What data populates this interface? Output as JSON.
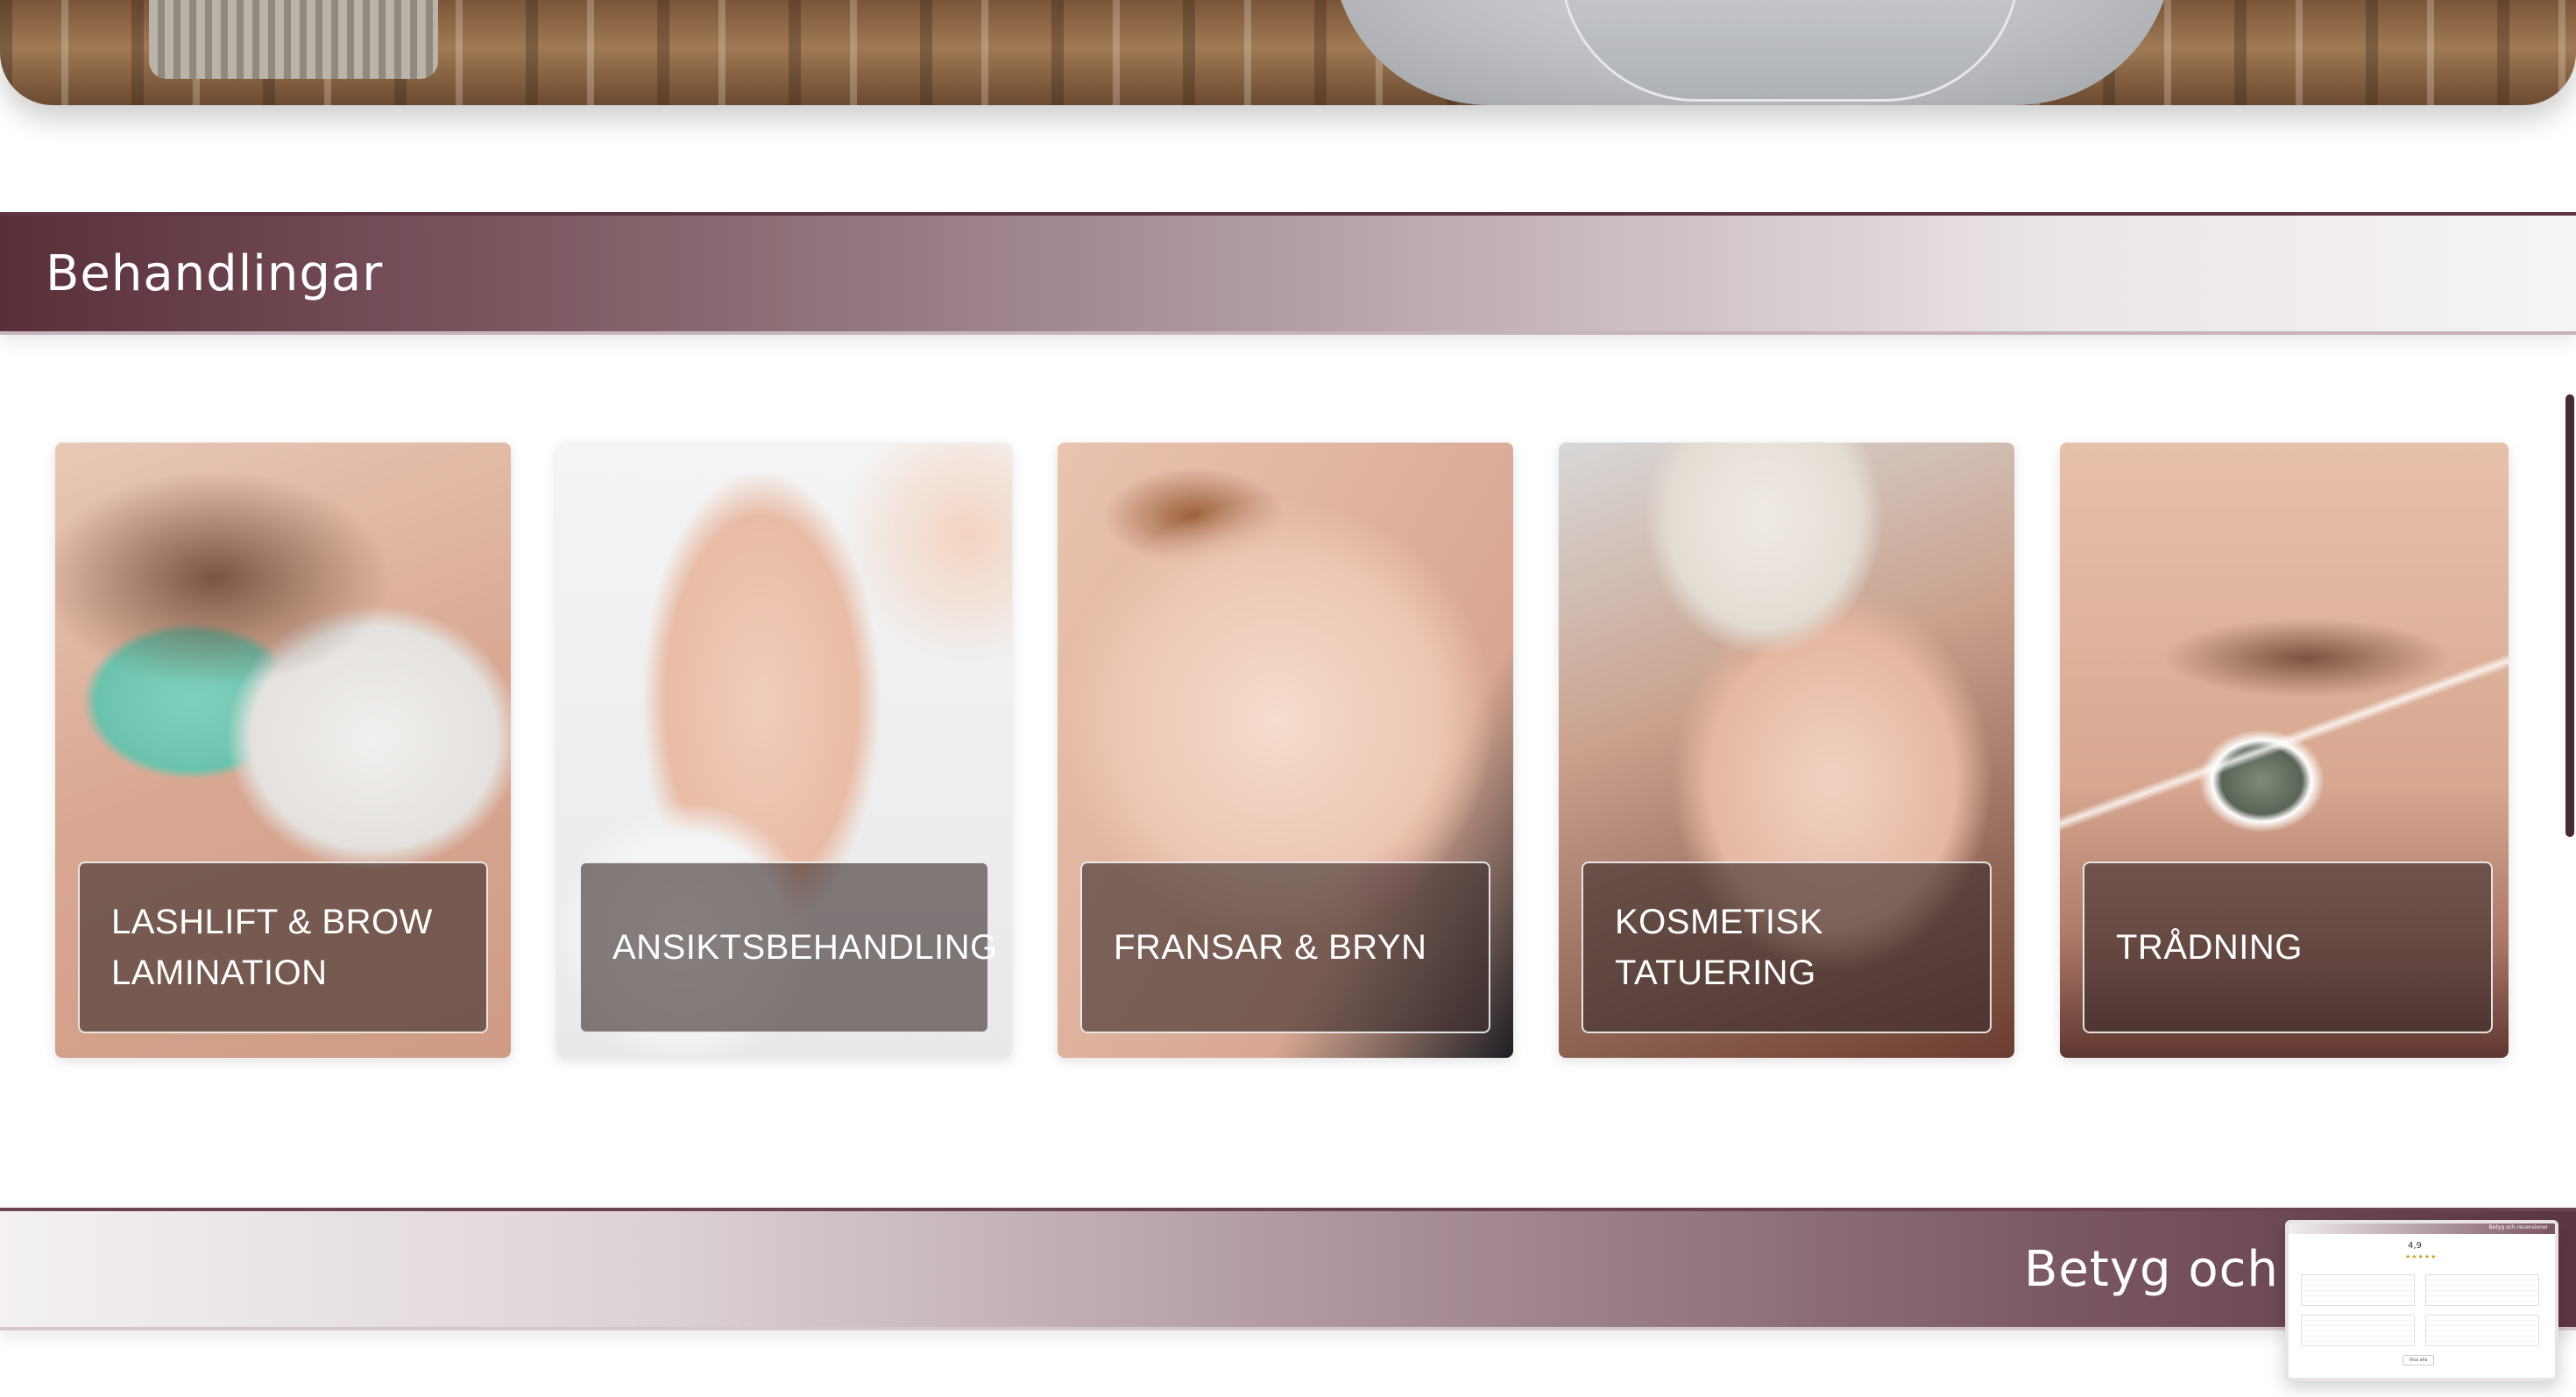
{
  "sections": {
    "treatments_title": "Behandlingar",
    "reviews_title": "Betyg och r"
  },
  "cards": [
    {
      "label": "LASHLIFT & BROW\nLAMINATION"
    },
    {
      "label": "ANSIKTSBEHANDLING"
    },
    {
      "label": "FRANSAR & BRYN"
    },
    {
      "label": "KOSMETISK\nTATUERING"
    },
    {
      "label": "TRÅDNING"
    }
  ],
  "review_widget": {
    "header": "Betyg och recensioner",
    "score": "4,9",
    "stars": "★★★★★",
    "button": "Visa alla"
  },
  "colors": {
    "band_dark": "#5a2f3a",
    "band_light": "#f6f4f4",
    "card_label_bg": "rgba(60,45,45,0.62)",
    "scroll_thumb": "#4a2a31"
  }
}
